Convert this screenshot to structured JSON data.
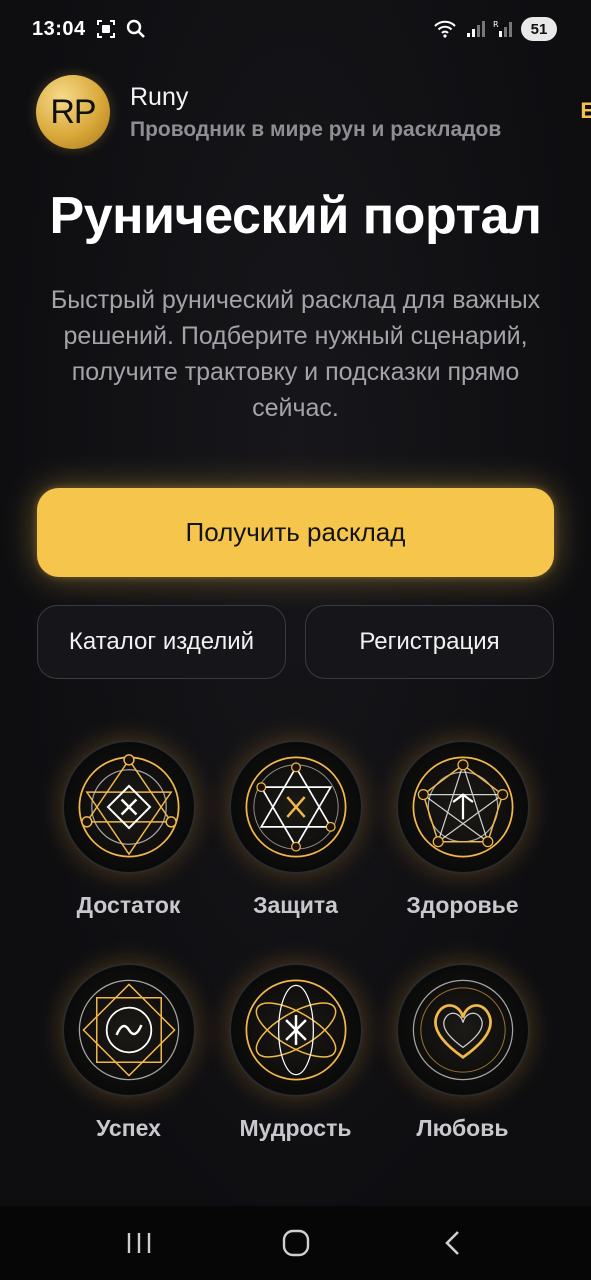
{
  "status_bar": {
    "time": "13:04",
    "battery": "51",
    "icons": [
      "screenshot-icon",
      "search-icon",
      "wifi-icon",
      "signal-icon",
      "signal-roaming-icon"
    ]
  },
  "header": {
    "avatar_initials": "RP",
    "app_name": "Runy",
    "tagline": "Проводник в мире рун и раскладов",
    "edge_letter": "E"
  },
  "hero": {
    "title": "Рунический портал",
    "description": "Быстрый рунический расклад для важных решений. Подберите нужный сценарий, получите трактовку и подсказки прямо сейчас."
  },
  "actions": {
    "primary_label": "Получить расклад",
    "catalog_label": "Каталог изделий",
    "register_label": "Регистрация"
  },
  "runes": [
    {
      "label": "Достаток",
      "icon": "rune-wealth-icon"
    },
    {
      "label": "Защита",
      "icon": "rune-protection-icon"
    },
    {
      "label": "Здоровье",
      "icon": "rune-health-icon"
    },
    {
      "label": "Успех",
      "icon": "rune-success-icon"
    },
    {
      "label": "Мудрость",
      "icon": "rune-wisdom-icon"
    },
    {
      "label": "Любовь",
      "icon": "rune-love-icon"
    }
  ],
  "colors": {
    "accent": "#f6c54c",
    "background": "#0f0f12",
    "glow": "#f0aa32"
  },
  "nav": [
    "recent-apps-icon",
    "home-icon",
    "back-icon"
  ]
}
